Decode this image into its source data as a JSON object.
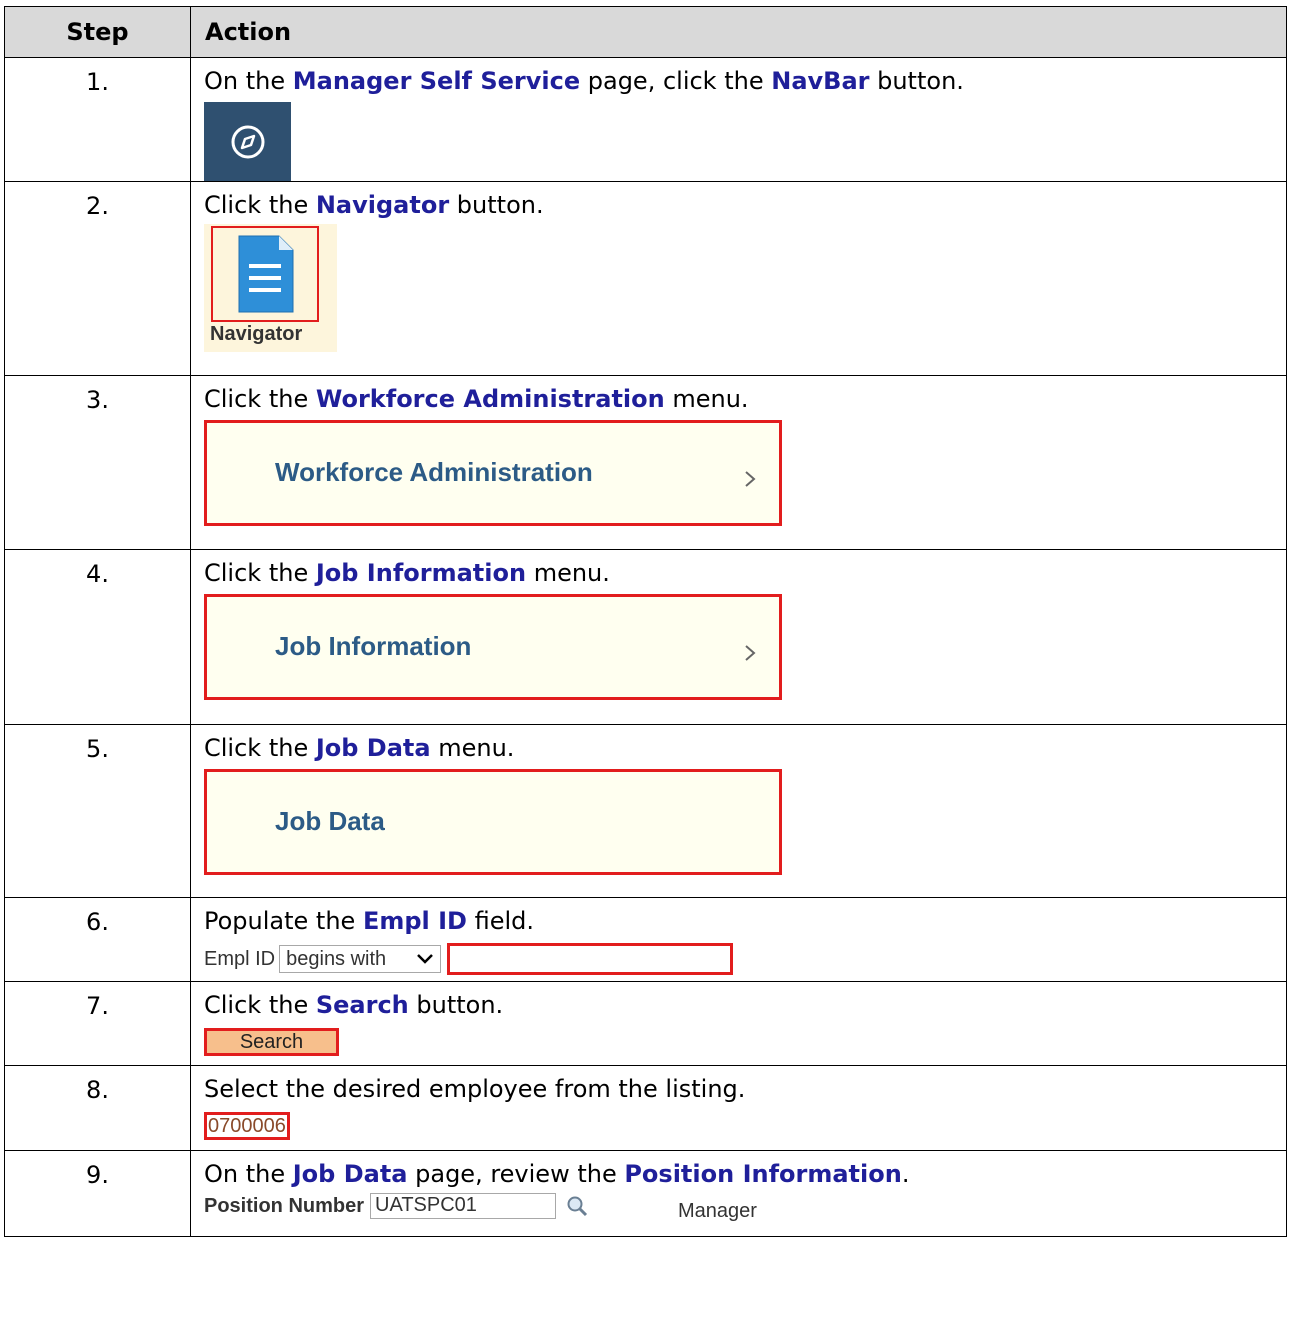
{
  "header": {
    "step": "Step",
    "action": "Action"
  },
  "steps": [
    {
      "num": "1.",
      "parts": [
        "On the ",
        "Manager Self Service",
        " page, click the ",
        "NavBar",
        " button."
      ]
    },
    {
      "num": "2.",
      "parts": [
        "Click the ",
        "Navigator",
        " button."
      ],
      "tile_label": "Navigator"
    },
    {
      "num": "3.",
      "parts": [
        "Click the ",
        "Workforce Administration",
        " menu."
      ],
      "menu_label": "Workforce Administration"
    },
    {
      "num": "4.",
      "parts": [
        "Click the ",
        "Job Information",
        " menu."
      ],
      "menu_label": "Job Information"
    },
    {
      "num": "5.",
      "parts": [
        "Click the ",
        "Job Data",
        " menu."
      ],
      "menu_label": "Job Data"
    },
    {
      "num": "6.",
      "parts": [
        "Populate the ",
        "Empl ID",
        " field."
      ],
      "field_label": "Empl ID",
      "operator": "begins with",
      "value": ""
    },
    {
      "num": "7.",
      "parts": [
        "Click the ",
        "Search",
        " button."
      ],
      "button_label": "Search"
    },
    {
      "num": "8.",
      "parts": [
        "Select the desired employee from the listing."
      ],
      "employee": "0700006"
    },
    {
      "num": "9.",
      "parts": [
        "On the ",
        "Job Data",
        " page, review the ",
        "Position Information",
        "."
      ],
      "field_label": "Position Number",
      "value": "UATSPC01",
      "description": "Manager"
    }
  ],
  "colors": {
    "highlight_text": "#1f1f9a",
    "callout_border": "#e21d1d",
    "menu_text": "#2c5b86",
    "header_bg": "#d9d9d9"
  }
}
